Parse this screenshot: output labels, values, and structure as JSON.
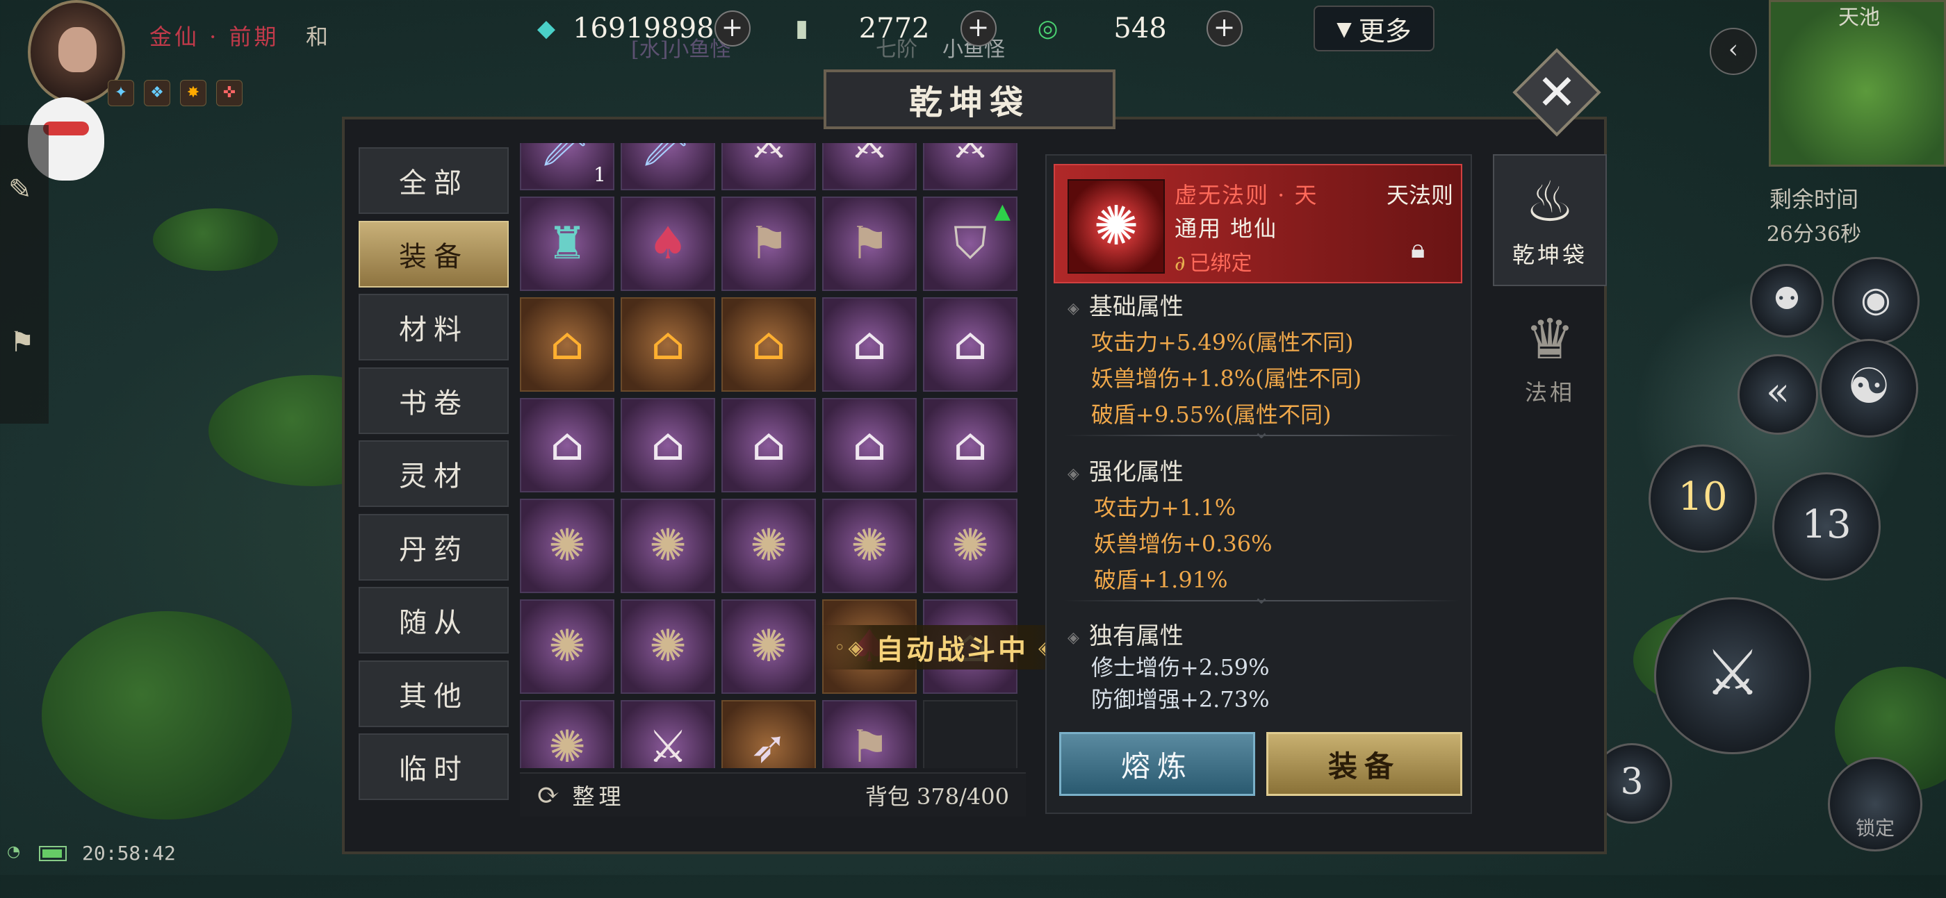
{
  "player": {
    "rank": "金仙 · 前期",
    "rank_suffix": "和",
    "buff_icons": [
      "buff-icon-1",
      "buff-icon-2",
      "buff-icon-3",
      "buff-icon-4"
    ]
  },
  "background_labels": {
    "enemy_tag": "[水]小鱼怪",
    "enemy_stage": "七阶",
    "enemy_name": "小鱼怪"
  },
  "resources": [
    {
      "name": "spirit-crystal",
      "icon": "crystal-icon",
      "value": "16919898"
    },
    {
      "name": "token",
      "icon": "token-icon",
      "value": "2772"
    },
    {
      "name": "jade",
      "icon": "jade-icon",
      "value": "548"
    }
  ],
  "more_label": "更多",
  "minimap": {
    "title": "天池"
  },
  "timer": {
    "label": "剩余时间",
    "value": "26分36秒"
  },
  "panel": {
    "title": "乾坤袋"
  },
  "categories": [
    {
      "label": "全部",
      "active": false
    },
    {
      "label": "装备",
      "active": true
    },
    {
      "label": "材料",
      "active": false
    },
    {
      "label": "书卷",
      "active": false
    },
    {
      "label": "灵材",
      "active": false
    },
    {
      "label": "丹药",
      "active": false
    },
    {
      "label": "随从",
      "active": false
    },
    {
      "label": "其他",
      "active": false
    },
    {
      "label": "临时",
      "active": false
    }
  ],
  "grid": [
    {
      "icon": "sword-icon",
      "style": "purple",
      "qty": "1"
    },
    {
      "icon": "sword-icon",
      "style": "purple",
      "qty": ""
    },
    {
      "icon": "blade-icon",
      "style": "purple",
      "qty": ""
    },
    {
      "icon": "blade-icon",
      "style": "purple",
      "qty": ""
    },
    {
      "icon": "blade-icon",
      "style": "purple",
      "qty": ""
    },
    {
      "icon": "lantern-icon",
      "style": "purple",
      "qty": ""
    },
    {
      "icon": "cape-icon",
      "style": "purple",
      "qty": ""
    },
    {
      "icon": "banner-icon",
      "style": "purple",
      "qty": ""
    },
    {
      "icon": "banner-icon",
      "style": "purple",
      "qty": ""
    },
    {
      "icon": "shield-icon",
      "style": "purple",
      "qty": "",
      "upgrade": true
    },
    {
      "icon": "cauldron-icon",
      "style": "gold",
      "qty": ""
    },
    {
      "icon": "cauldron-icon",
      "style": "gold",
      "qty": ""
    },
    {
      "icon": "cauldron-icon",
      "style": "gold",
      "qty": ""
    },
    {
      "icon": "cauldron-icon",
      "style": "purple",
      "qty": ""
    },
    {
      "icon": "cauldron-icon",
      "style": "purple",
      "qty": ""
    },
    {
      "icon": "cauldron-icon",
      "style": "purple",
      "qty": ""
    },
    {
      "icon": "cauldron-icon",
      "style": "purple",
      "qty": ""
    },
    {
      "icon": "cauldron-icon",
      "style": "purple",
      "qty": ""
    },
    {
      "icon": "cauldron-icon",
      "style": "purple",
      "qty": ""
    },
    {
      "icon": "cauldron-icon",
      "style": "purple",
      "qty": ""
    },
    {
      "icon": "whisk-icon",
      "style": "purple",
      "qty": ""
    },
    {
      "icon": "whisk-icon",
      "style": "purple",
      "qty": ""
    },
    {
      "icon": "whisk-icon",
      "style": "purple",
      "qty": ""
    },
    {
      "icon": "whisk-icon",
      "style": "purple",
      "qty": ""
    },
    {
      "icon": "whisk-icon",
      "style": "purple",
      "qty": ""
    },
    {
      "icon": "whisk-icon",
      "style": "purple",
      "qty": ""
    },
    {
      "icon": "whisk-icon",
      "style": "purple",
      "qty": ""
    },
    {
      "icon": "whisk-icon",
      "style": "purple",
      "qty": ""
    },
    {
      "icon": "cape-icon",
      "style": "gold",
      "qty": ""
    },
    {
      "icon": "cauldron-icon",
      "style": "purple",
      "qty": ""
    },
    {
      "icon": "whisk-icon",
      "style": "purple",
      "qty": ""
    },
    {
      "icon": "blade-icon",
      "style": "purple",
      "qty": ""
    },
    {
      "icon": "spear-icon",
      "style": "gold",
      "qty": ""
    },
    {
      "icon": "banner-icon",
      "style": "purple",
      "qty": ""
    },
    {
      "icon": "",
      "style": "empty",
      "qty": ""
    }
  ],
  "auto_battle": "自动战斗中",
  "bag": {
    "sort_label": "整理",
    "count": "背包 378/400"
  },
  "item": {
    "name": "虚无法则 · 天",
    "grade": "天法则",
    "type": "通用 地仙",
    "bound": "已绑定",
    "sections": {
      "base_title": "基础属性",
      "base": [
        "攻击力+5.49%(属性不同)",
        "妖兽增伤+1.8%(属性不同)",
        "破盾+9.55%(属性不同)"
      ],
      "enhance_title": "强化属性",
      "enhance": [
        "攻击力+1.1%",
        "妖兽增伤+0.36%",
        "破盾+1.91%"
      ],
      "unique_title": "独有属性",
      "unique": [
        "修士增伤+2.59%",
        "防御增强+2.73%"
      ]
    }
  },
  "actions": {
    "smelt": "熔炼",
    "equip": "装备"
  },
  "side_tabs": [
    {
      "label": "乾坤袋",
      "icon": "bag-icon",
      "active": true
    },
    {
      "label": "法相",
      "icon": "avatar-form-icon",
      "active": false
    }
  ],
  "skills": {
    "cooldown_1": "10",
    "cooldown_2": "13",
    "count": "3",
    "lock_label": "锁定"
  },
  "status": {
    "clock": "20:58:42"
  },
  "colors": {
    "accent_gold": "#c8b078",
    "rare_red": "#b02828",
    "epic_purple": "#8a5a9a",
    "attr_orange": "#f0a84a"
  }
}
